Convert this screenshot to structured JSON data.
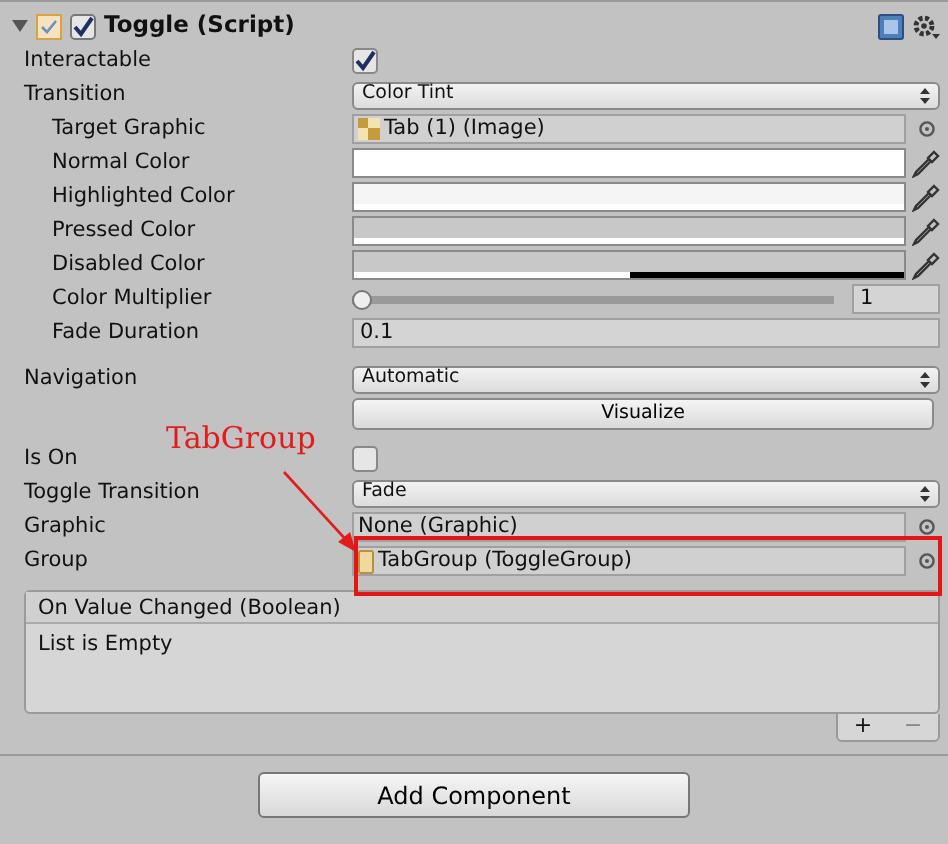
{
  "component": {
    "title": "Toggle (Script)",
    "expanded": true,
    "enabled": true
  },
  "sections": [
    [
      {
        "label": "Interactable",
        "kind": "checkbox",
        "checked": true
      },
      {
        "label": "Transition",
        "kind": "dropdown",
        "value": "Color Tint",
        "children": [
          {
            "label": "Target Graphic",
            "kind": "image_ref",
            "value": "Tab (1) (Image)"
          },
          {
            "label": "Normal Color",
            "kind": "color",
            "color": "#ffffff",
            "level": 1
          },
          {
            "label": "Highlighted Color",
            "kind": "color",
            "color": "#f5f5f5",
            "level": 1
          },
          {
            "label": "Pressed Color",
            "kind": "color",
            "color": "#c8c8c8",
            "level": 1
          },
          {
            "label": "Disabled Color",
            "kind": "color",
            "color": "#c8c8c8",
            "level": 0.5
          },
          {
            "label": "Color Multiplier",
            "kind": "slider",
            "level": 0,
            "value": "1"
          },
          {
            "label": "Fade Duration",
            "kind": "number",
            "value": "0.1"
          }
        ]
      }
    ],
    [
      {
        "label": "Navigation",
        "kind": "dropdown",
        "value": "Automatic"
      },
      {
        "kind": "button",
        "value": "Visualize"
      }
    ],
    [
      {
        "label": "Is On",
        "kind": "checkbox",
        "checked": false
      },
      {
        "label": "Toggle Transition",
        "kind": "dropdown",
        "value": "Fade"
      },
      {
        "label": "Graphic",
        "kind": "object",
        "value": "None (Graphic)"
      },
      {
        "label": "Group",
        "kind": "group_ref",
        "value": "TabGroup (ToggleGroup)",
        "highlighted": true
      }
    ]
  ],
  "event": {
    "title": "On Value Changed (Boolean)",
    "body": "List is Empty",
    "add": "+",
    "remove": "−"
  },
  "add_button": "Add Component",
  "annotation": {
    "label": "TabGroup"
  }
}
